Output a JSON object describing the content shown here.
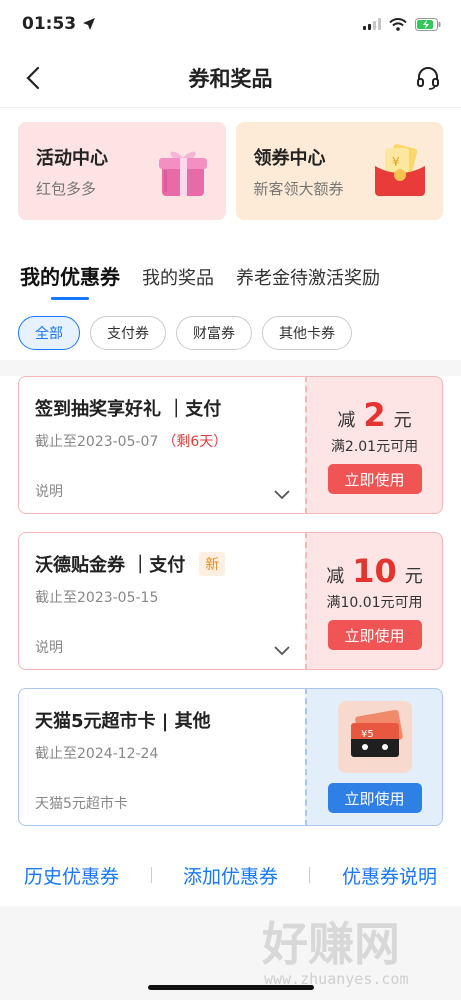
{
  "status": {
    "time": "01:53",
    "icons": [
      "location-arrow-icon",
      "signal-icon",
      "wifi-icon",
      "battery-charging-icon"
    ]
  },
  "nav": {
    "title": "券和奖品",
    "back_icon": "back-arrow-icon",
    "service_icon": "headset-icon"
  },
  "entries": [
    {
      "title": "活动中心",
      "subtitle": "红包多多",
      "icon": "gift-box-icon"
    },
    {
      "title": "领券中心",
      "subtitle": "新客领大额券",
      "icon": "red-envelope-icon"
    }
  ],
  "tabs": [
    {
      "label": "我的优惠券",
      "active": true
    },
    {
      "label": "我的奖品",
      "active": false
    },
    {
      "label": "养老金待激活奖励",
      "active": false
    }
  ],
  "filters": [
    {
      "label": "全部",
      "active": true
    },
    {
      "label": "支付券",
      "active": false
    },
    {
      "label": "财富券",
      "active": false
    },
    {
      "label": "其他卡券",
      "active": false
    }
  ],
  "coupons": [
    {
      "title": "签到抽奖享好礼 ｜支付",
      "date": "截止至2023-05-07",
      "remain": "（剩6天）",
      "note": "说明",
      "amount_prefix": "减",
      "amount": "2",
      "unit": "元",
      "condition": "满2.01元可用",
      "button": "立即使用"
    },
    {
      "title": "沃德贴金券 ｜支付",
      "badge": "新",
      "date": "截止至2023-05-15",
      "note": "说明",
      "amount_prefix": "减",
      "amount": "10",
      "unit": "元",
      "condition": "满10.01元可用",
      "button": "立即使用"
    },
    {
      "title": "天猫5元超市卡 | 其他",
      "date": "截止至2024-12-24",
      "note": "天猫5元超市卡",
      "card_label": "¥5",
      "button": "立即使用"
    }
  ],
  "footer": {
    "links": [
      "历史优惠券",
      "添加优惠券",
      "优惠券说明"
    ]
  },
  "watermark": {
    "title": "好赚网",
    "url": "www.zhuanyes.com"
  },
  "colors": {
    "accent_blue": "#1677ff",
    "coupon_red": "#f05454",
    "amount_red": "#e5342f",
    "card_blue": "#2f80e6"
  }
}
